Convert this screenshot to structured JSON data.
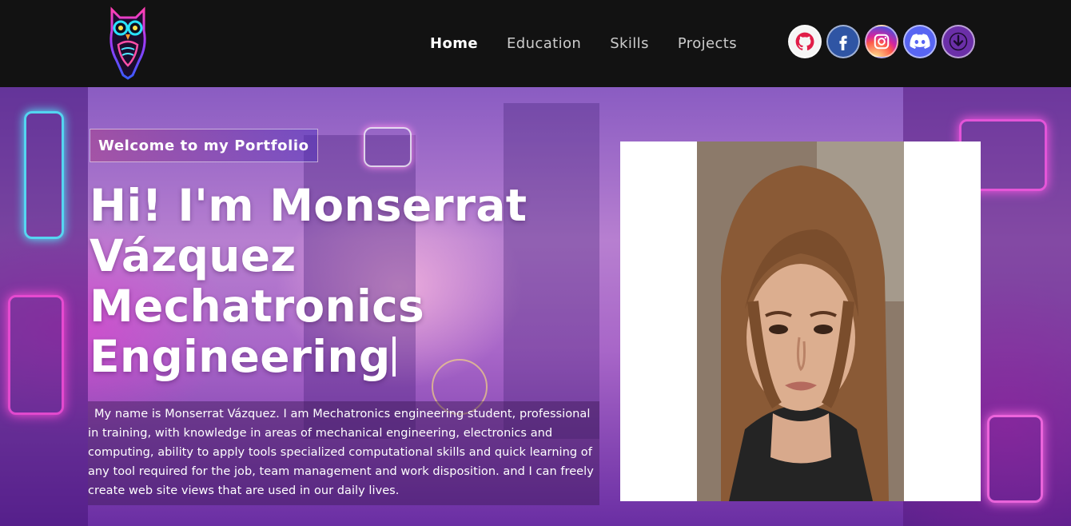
{
  "navbar": {
    "logo_icon": "owl-logo-icon",
    "links": [
      "Home",
      "Education",
      "Skills",
      "Projects"
    ],
    "active_link": "Home",
    "social": [
      {
        "icon": "github-icon",
        "color": "#f5f5f5"
      },
      {
        "icon": "facebook-icon",
        "color": "#2f55a4"
      },
      {
        "icon": "instagram-icon",
        "color": "#d6249f"
      },
      {
        "icon": "discord-icon",
        "color": "#5865f2"
      },
      {
        "icon": "download-icon",
        "color": "#6b2fa8"
      }
    ]
  },
  "banner": {
    "tagline": "Welcome to my Portfolio",
    "headline": [
      "Hi! I'm Monserrat",
      "Vázquez",
      "Mechatronics",
      "Engineering"
    ],
    "description": "My name is Monserrat Vázquez. I am Mechatronics engineering student, professional in training, with knowledge in areas of mechanical engineering, electronics and computing, ability to apply tools specialized computational skills and quick learning of any tool required for the job, team management and work disposition. and I can freely create web site views that are used in our daily lives.",
    "photo_icon": "profile-photo",
    "background": "neon-city-street"
  },
  "colors": {
    "navbar_bg": "#121212",
    "accent_pink": "#aa367c",
    "accent_purple": "#4a2fbd"
  }
}
